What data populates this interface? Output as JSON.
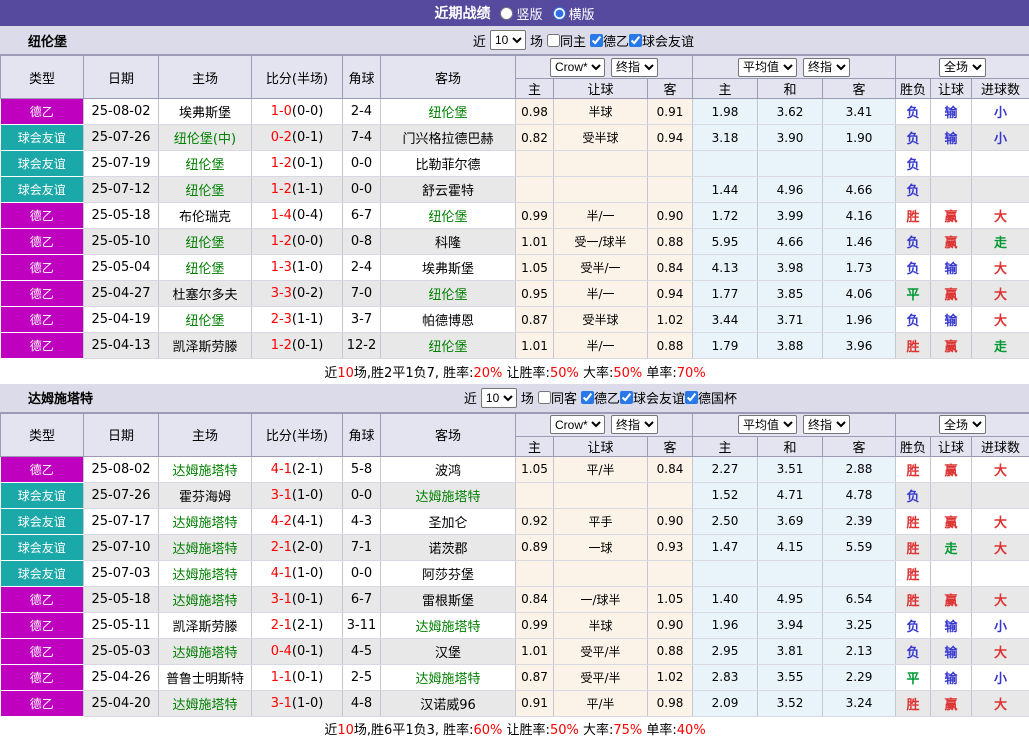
{
  "titlebar": {
    "title": "近期战绩",
    "layout_options": [
      {
        "label": "竖版",
        "selected": false
      },
      {
        "label": "横版",
        "selected": true
      }
    ]
  },
  "colors": {
    "topbar": "#564a9e",
    "team_highlight": "#008000",
    "score_red": "#ff0000",
    "summary_red": "#e00000",
    "win": "#dd3333",
    "draw": "#009933",
    "lose": "#3838cf"
  },
  "type_colors": {
    "德乙": "#bf00bf",
    "球会友谊": "#1ba8a8"
  },
  "header": {
    "left_cols": [
      "类型",
      "日期",
      "主场",
      "比分(半场)",
      "角球",
      "客场"
    ],
    "odds_group": [
      "主",
      "让球",
      "客"
    ],
    "avg_group": [
      "主",
      "和",
      "客"
    ],
    "result_group": [
      "胜负",
      "让球",
      "进球数"
    ],
    "selects": {
      "odds_source": "Crow*",
      "odds_stage": "终指",
      "avg_source": "平均值",
      "avg_stage": "终指",
      "scope": "全场"
    }
  },
  "sections": [
    {
      "team": "纽伦堡",
      "filter": {
        "near": "近",
        "count": "10",
        "games": "场",
        "same": {
          "label": "同主",
          "checked": false
        },
        "leagues": [
          {
            "label": "德乙",
            "checked": true
          },
          {
            "label": "球会友谊",
            "checked": true
          }
        ]
      },
      "rows": [
        {
          "type": "德乙",
          "date": "25-08-02",
          "home": "埃弗斯堡",
          "home_hl": false,
          "score": "1-0",
          "half": "(0-0)",
          "corner": "2-4",
          "away": "纽伦堡",
          "away_hl": true,
          "odds": [
            "0.98",
            "半球",
            "0.91"
          ],
          "avg": [
            "1.98",
            "3.62",
            "3.41"
          ],
          "result": "负",
          "handicap": "输",
          "goals": "小"
        },
        {
          "type": "球会友谊",
          "date": "25-07-26",
          "home": "纽伦堡(中)",
          "home_hl": true,
          "score": "0-2",
          "half": "(0-1)",
          "corner": "7-4",
          "away": "门兴格拉德巴赫",
          "away_hl": false,
          "odds": [
            "0.82",
            "受半球",
            "0.94"
          ],
          "avg": [
            "3.18",
            "3.90",
            "1.90"
          ],
          "result": "负",
          "handicap": "输",
          "goals": "小"
        },
        {
          "type": "球会友谊",
          "date": "25-07-19",
          "home": "纽伦堡",
          "home_hl": true,
          "score": "1-2",
          "half": "(0-1)",
          "corner": "0-0",
          "away": "比勒菲尔德",
          "away_hl": false,
          "odds": [
            "",
            "",
            ""
          ],
          "avg": [
            "",
            "",
            ""
          ],
          "result": "负",
          "handicap": "",
          "goals": ""
        },
        {
          "type": "球会友谊",
          "date": "25-07-12",
          "home": "纽伦堡",
          "home_hl": true,
          "score": "1-2",
          "half": "(1-1)",
          "corner": "0-0",
          "away": "舒云霍特",
          "away_hl": false,
          "odds": [
            "",
            "",
            ""
          ],
          "avg": [
            "1.44",
            "4.96",
            "4.66"
          ],
          "result": "负",
          "handicap": "",
          "goals": ""
        },
        {
          "type": "德乙",
          "date": "25-05-18",
          "home": "布伦瑞克",
          "home_hl": false,
          "score": "1-4",
          "half": "(0-4)",
          "corner": "6-7",
          "away": "纽伦堡",
          "away_hl": true,
          "odds": [
            "0.99",
            "半/一",
            "0.90"
          ],
          "avg": [
            "1.72",
            "3.99",
            "4.16"
          ],
          "result": "胜",
          "handicap": "赢",
          "goals": "大"
        },
        {
          "type": "德乙",
          "date": "25-05-10",
          "home": "纽伦堡",
          "home_hl": true,
          "score": "1-2",
          "half": "(0-0)",
          "corner": "0-8",
          "away": "科隆",
          "away_hl": false,
          "odds": [
            "1.01",
            "受一/球半",
            "0.88"
          ],
          "avg": [
            "5.95",
            "4.66",
            "1.46"
          ],
          "result": "负",
          "handicap": "赢",
          "goals": "走"
        },
        {
          "type": "德乙",
          "date": "25-05-04",
          "home": "纽伦堡",
          "home_hl": true,
          "score": "1-3",
          "half": "(1-0)",
          "corner": "2-4",
          "away": "埃弗斯堡",
          "away_hl": false,
          "odds": [
            "1.05",
            "受半/一",
            "0.84"
          ],
          "avg": [
            "4.13",
            "3.98",
            "1.73"
          ],
          "result": "负",
          "handicap": "输",
          "goals": "大"
        },
        {
          "type": "德乙",
          "date": "25-04-27",
          "home": "杜塞尔多夫",
          "home_hl": false,
          "score": "3-3",
          "half": "(0-2)",
          "corner": "7-0",
          "away": "纽伦堡",
          "away_hl": true,
          "odds": [
            "0.95",
            "半/一",
            "0.94"
          ],
          "avg": [
            "1.77",
            "3.85",
            "4.06"
          ],
          "result": "平",
          "handicap": "赢",
          "goals": "大"
        },
        {
          "type": "德乙",
          "date": "25-04-19",
          "home": "纽伦堡",
          "home_hl": true,
          "score": "2-3",
          "half": "(1-1)",
          "corner": "3-7",
          "away": "帕德博恩",
          "away_hl": false,
          "odds": [
            "0.87",
            "受半球",
            "1.02"
          ],
          "avg": [
            "3.44",
            "3.71",
            "1.96"
          ],
          "result": "负",
          "handicap": "输",
          "goals": "大"
        },
        {
          "type": "德乙",
          "date": "25-04-13",
          "home": "凯泽斯劳滕",
          "home_hl": false,
          "score": "1-2",
          "half": "(0-1)",
          "corner": "12-2",
          "away": "纽伦堡",
          "away_hl": true,
          "odds": [
            "1.01",
            "半/一",
            "0.88"
          ],
          "avg": [
            "1.79",
            "3.88",
            "3.96"
          ],
          "result": "胜",
          "handicap": "赢",
          "goals": "走"
        }
      ],
      "summary": [
        {
          "t": "近"
        },
        {
          "t": "10",
          "red": true
        },
        {
          "t": "场,胜2平1负7, 胜率:"
        },
        {
          "t": "20%",
          "red": true
        },
        {
          "t": " 让胜率:"
        },
        {
          "t": "50%",
          "red": true
        },
        {
          "t": " 大率:"
        },
        {
          "t": "50%",
          "red": true
        },
        {
          "t": " 单率:"
        },
        {
          "t": "70%",
          "red": true
        }
      ]
    },
    {
      "team": "达姆施塔特",
      "filter": {
        "near": "近",
        "count": "10",
        "games": "场",
        "same": {
          "label": "同客",
          "checked": false
        },
        "leagues": [
          {
            "label": "德乙",
            "checked": true
          },
          {
            "label": "球会友谊",
            "checked": true
          },
          {
            "label": "德国杯",
            "checked": true
          }
        ]
      },
      "rows": [
        {
          "type": "德乙",
          "date": "25-08-02",
          "home": "达姆施塔特",
          "home_hl": true,
          "score": "4-1",
          "half": "(2-1)",
          "corner": "5-8",
          "away": "波鸿",
          "away_hl": false,
          "odds": [
            "1.05",
            "平/半",
            "0.84"
          ],
          "avg": [
            "2.27",
            "3.51",
            "2.88"
          ],
          "result": "胜",
          "handicap": "赢",
          "goals": "大"
        },
        {
          "type": "球会友谊",
          "date": "25-07-26",
          "home": "霍芬海姆",
          "home_hl": false,
          "score": "3-1",
          "half": "(1-0)",
          "corner": "0-0",
          "away": "达姆施塔特",
          "away_hl": true,
          "odds": [
            "",
            "",
            ""
          ],
          "avg": [
            "1.52",
            "4.71",
            "4.78"
          ],
          "result": "负",
          "handicap": "",
          "goals": ""
        },
        {
          "type": "球会友谊",
          "date": "25-07-17",
          "home": "达姆施塔特",
          "home_hl": true,
          "score": "4-2",
          "half": "(4-1)",
          "corner": "4-3",
          "away": "圣加仑",
          "away_hl": false,
          "odds": [
            "0.92",
            "平手",
            "0.90"
          ],
          "avg": [
            "2.50",
            "3.69",
            "2.39"
          ],
          "result": "胜",
          "handicap": "赢",
          "goals": "大"
        },
        {
          "type": "球会友谊",
          "date": "25-07-10",
          "home": "达姆施塔特",
          "home_hl": true,
          "score": "2-1",
          "half": "(2-0)",
          "corner": "7-1",
          "away": "诺茨郡",
          "away_hl": false,
          "odds": [
            "0.89",
            "一球",
            "0.93"
          ],
          "avg": [
            "1.47",
            "4.15",
            "5.59"
          ],
          "result": "胜",
          "handicap": "走",
          "goals": "大"
        },
        {
          "type": "球会友谊",
          "date": "25-07-03",
          "home": "达姆施塔特",
          "home_hl": true,
          "score": "4-1",
          "half": "(1-0)",
          "corner": "0-0",
          "away": "阿莎芬堡",
          "away_hl": false,
          "odds": [
            "",
            "",
            ""
          ],
          "avg": [
            "",
            "",
            ""
          ],
          "result": "胜",
          "handicap": "",
          "goals": ""
        },
        {
          "type": "德乙",
          "date": "25-05-18",
          "home": "达姆施塔特",
          "home_hl": true,
          "score": "3-1",
          "half": "(0-1)",
          "corner": "6-7",
          "away": "雷根斯堡",
          "away_hl": false,
          "odds": [
            "0.84",
            "一/球半",
            "1.05"
          ],
          "avg": [
            "1.40",
            "4.95",
            "6.54"
          ],
          "result": "胜",
          "handicap": "赢",
          "goals": "大"
        },
        {
          "type": "德乙",
          "date": "25-05-11",
          "home": "凯泽斯劳滕",
          "home_hl": false,
          "score": "2-1",
          "half": "(2-1)",
          "corner": "3-11",
          "away": "达姆施塔特",
          "away_hl": true,
          "odds": [
            "0.99",
            "半球",
            "0.90"
          ],
          "avg": [
            "1.96",
            "3.94",
            "3.25"
          ],
          "result": "负",
          "handicap": "输",
          "goals": "小"
        },
        {
          "type": "德乙",
          "date": "25-05-03",
          "home": "达姆施塔特",
          "home_hl": true,
          "score": "0-4",
          "half": "(0-1)",
          "corner": "4-5",
          "away": "汉堡",
          "away_hl": false,
          "odds": [
            "1.01",
            "受平/半",
            "0.88"
          ],
          "avg": [
            "2.95",
            "3.81",
            "2.13"
          ],
          "result": "负",
          "handicap": "输",
          "goals": "大"
        },
        {
          "type": "德乙",
          "date": "25-04-26",
          "home": "普鲁士明斯特",
          "home_hl": false,
          "score": "1-1",
          "half": "(0-1)",
          "corner": "2-5",
          "away": "达姆施塔特",
          "away_hl": true,
          "odds": [
            "0.87",
            "受平/半",
            "1.02"
          ],
          "avg": [
            "2.83",
            "3.55",
            "2.29"
          ],
          "result": "平",
          "handicap": "输",
          "goals": "小"
        },
        {
          "type": "德乙",
          "date": "25-04-20",
          "home": "达姆施塔特",
          "home_hl": true,
          "score": "3-1",
          "half": "(1-0)",
          "corner": "4-8",
          "away": "汉诺威96",
          "away_hl": false,
          "odds": [
            "0.91",
            "平/半",
            "0.98"
          ],
          "avg": [
            "2.09",
            "3.52",
            "3.24"
          ],
          "result": "胜",
          "handicap": "赢",
          "goals": "大"
        }
      ],
      "summary": [
        {
          "t": "近"
        },
        {
          "t": "10",
          "red": true
        },
        {
          "t": "场,胜6平1负3, 胜率:"
        },
        {
          "t": "60%",
          "red": true
        },
        {
          "t": " 让胜率:"
        },
        {
          "t": "50%",
          "red": true
        },
        {
          "t": " 大率:"
        },
        {
          "t": "75%",
          "red": true
        },
        {
          "t": " 单率:"
        },
        {
          "t": "40%",
          "red": true
        }
      ]
    }
  ]
}
